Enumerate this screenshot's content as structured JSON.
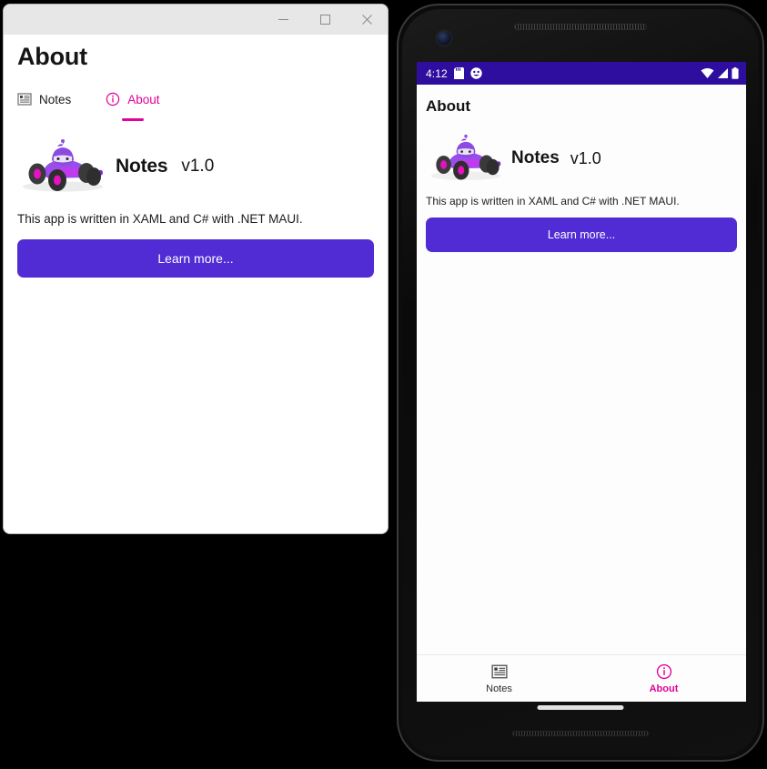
{
  "desktop": {
    "titlebar": {
      "minimize_label": "Minimize",
      "maximize_label": "Maximize",
      "close_label": "Close"
    },
    "page_title": "About",
    "tabs": [
      {
        "label": "Notes",
        "icon": "notes-list-icon",
        "active": false
      },
      {
        "label": "About",
        "icon": "info-circle-icon",
        "active": true
      }
    ],
    "app": {
      "logo_alt": "dotnet-bot-racecar",
      "name": "Notes",
      "version": "v1.0",
      "description": "This app is written in XAML and C# with .NET MAUI.",
      "learn_more_label": "Learn more..."
    }
  },
  "phone": {
    "status_bar": {
      "time": "4:12",
      "left_icons": [
        "sd-card-icon",
        "emoji-face-icon"
      ],
      "right_icons": [
        "wifi-icon",
        "cell-signal-icon",
        "battery-icon"
      ],
      "background": "#2E0E9E"
    },
    "page_title": "About",
    "app": {
      "logo_alt": "dotnet-bot-racecar",
      "name": "Notes",
      "version": "v1.0",
      "description": "This app is written in XAML and C# with .NET MAUI.",
      "learn_more_label": "Learn more..."
    },
    "tabs": [
      {
        "label": "Notes",
        "icon": "notes-list-icon",
        "active": false
      },
      {
        "label": "About",
        "icon": "info-circle-icon",
        "active": true
      }
    ]
  },
  "colors": {
    "brand_purple": "#512BD4",
    "accent_magenta": "#E3009B",
    "status_bar_purple": "#2E0E9E",
    "window_titlebar": "#E7E7E7",
    "page_background": "#000000"
  }
}
